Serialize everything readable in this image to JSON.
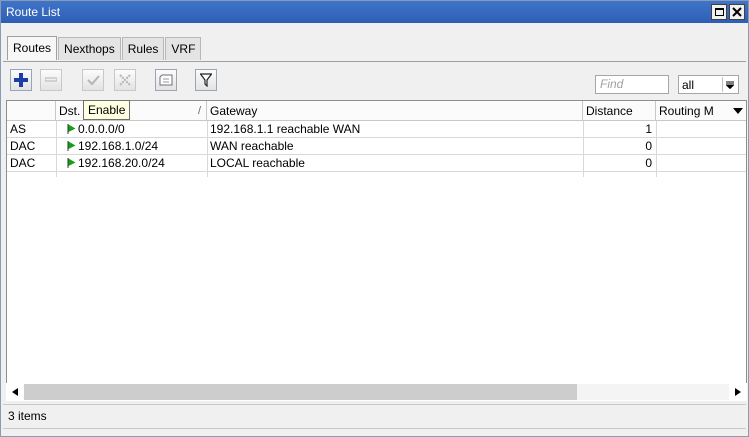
{
  "window": {
    "title": "Route List"
  },
  "tabs": [
    {
      "label": "Routes",
      "active": true
    },
    {
      "label": "Nexthops",
      "active": false
    },
    {
      "label": "Rules",
      "active": false
    },
    {
      "label": "VRF",
      "active": false
    }
  ],
  "toolbar": {
    "add_icon": "plus-icon",
    "remove_icon": "minus-icon",
    "enable_icon": "check-icon",
    "disable_icon": "x-icon",
    "comment_icon": "comment-icon",
    "filter_icon": "filter-icon",
    "find_placeholder": "Find",
    "filter_select_value": "all"
  },
  "tooltip": {
    "text": "Enable"
  },
  "table": {
    "columns": {
      "type": "",
      "dst": "Dst.",
      "gateway": "Gateway",
      "distance": "Distance",
      "routing_mark": "Routing M"
    },
    "rows": [
      {
        "type": "AS",
        "dst": "0.0.0.0/0",
        "gateway": "192.168.1.1 reachable WAN",
        "distance": "1",
        "routing_mark": ""
      },
      {
        "type": "DAC",
        "dst": "192.168.1.0/24",
        "gateway": "WAN reachable",
        "distance": "0",
        "routing_mark": ""
      },
      {
        "type": "DAC",
        "dst": "192.168.20.0/24",
        "gateway": "LOCAL reachable",
        "distance": "0",
        "routing_mark": ""
      }
    ]
  },
  "status": {
    "text": "3 items"
  },
  "colors": {
    "titlebar": "#2e5fb6",
    "flag": "#14a014",
    "add": "#1a3fa8",
    "tooltip_bg": "#ffffe1"
  }
}
